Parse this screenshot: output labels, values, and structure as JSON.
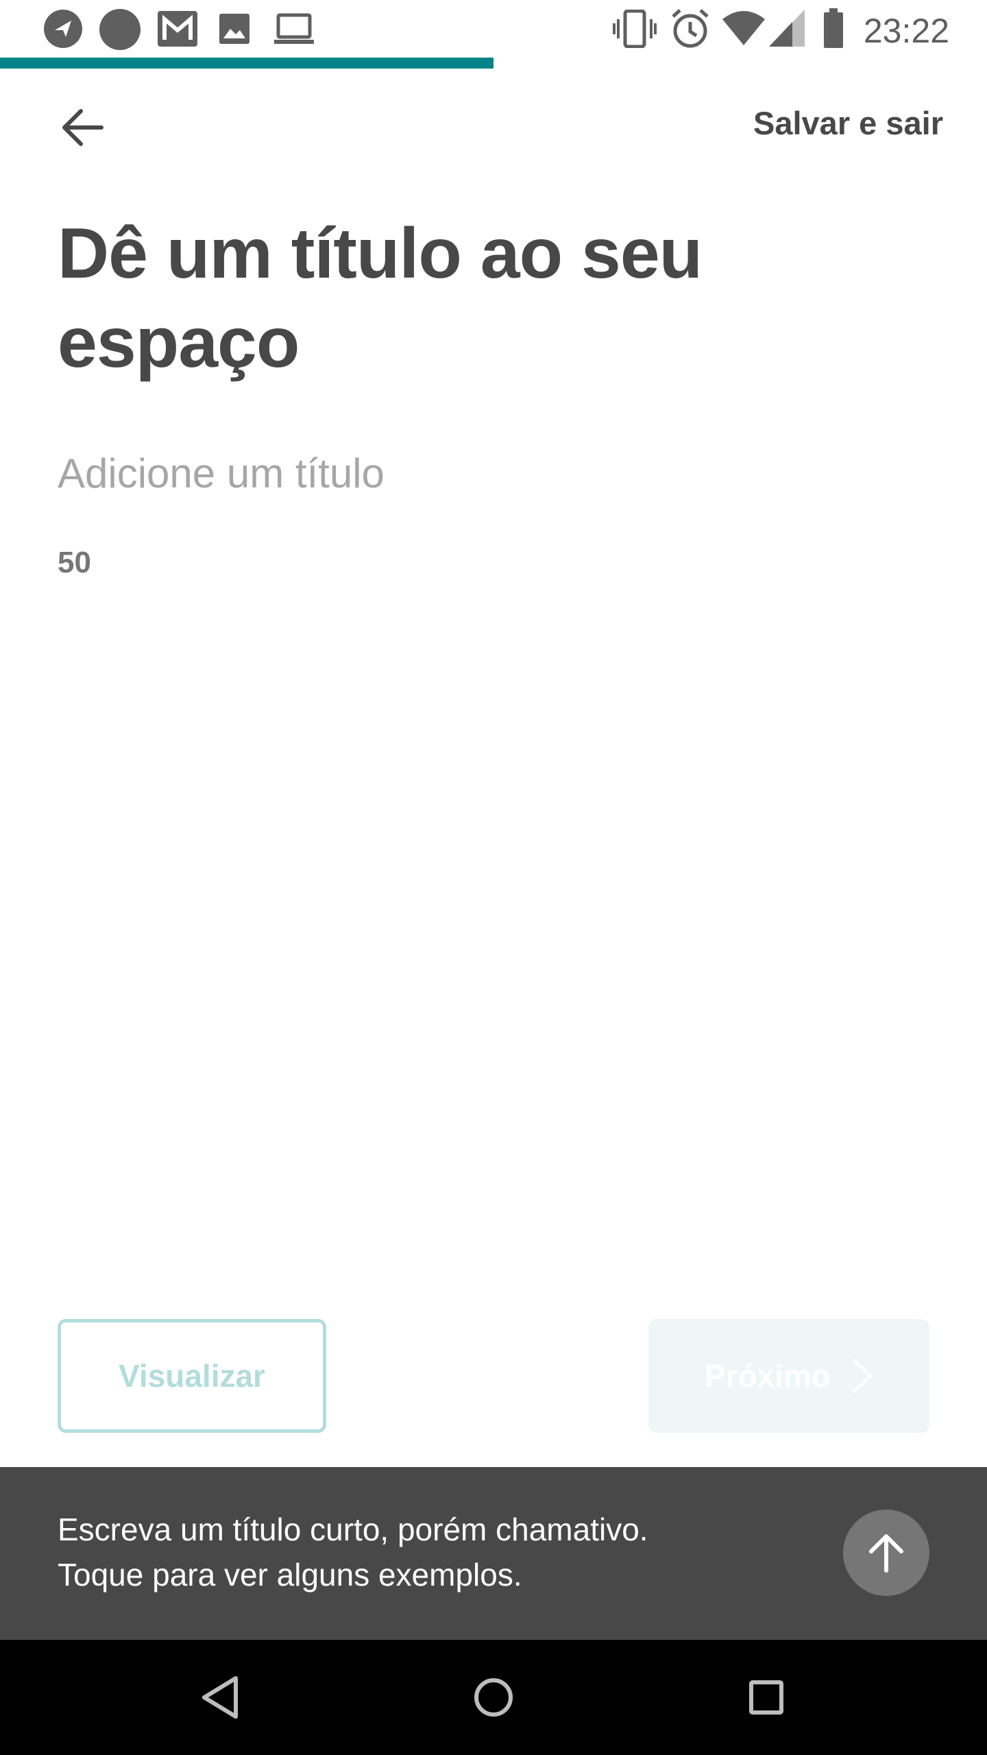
{
  "status_bar": {
    "time": "23:22",
    "left_icons": [
      "navigation-icon",
      "circle-notification-icon",
      "gmail-icon",
      "image-icon",
      "laptop-icon"
    ],
    "right_icons": [
      "vibrate-icon",
      "alarm-icon",
      "wifi-icon",
      "signal-icon",
      "battery-icon"
    ]
  },
  "progress": {
    "fraction": 0.5,
    "color": "#008489"
  },
  "header": {
    "back_icon": "arrow-left-icon",
    "save_exit_label": "Salvar e sair"
  },
  "page": {
    "title": "Dê um título ao seu espaço",
    "input_placeholder": "Adicione um título",
    "input_value": "",
    "char_count": "50"
  },
  "buttons": {
    "preview_label": "Visualizar",
    "next_label": "Próximo",
    "next_icon": "chevron-right-icon"
  },
  "tip": {
    "text_line1": "Escreva um título curto, porém chamativo.",
    "text_line2": "Toque para ver alguns exemplos.",
    "icon": "arrow-up-icon"
  },
  "nav_bar": {
    "icons": [
      "nav-back-icon",
      "nav-home-icon",
      "nav-recents-icon"
    ]
  },
  "colors": {
    "brand": "#008489",
    "text_dark": "#484848",
    "tip_background": "#484848",
    "disabled_outline": "#b3dcdd",
    "disabled_fill": "#eef7f6"
  }
}
